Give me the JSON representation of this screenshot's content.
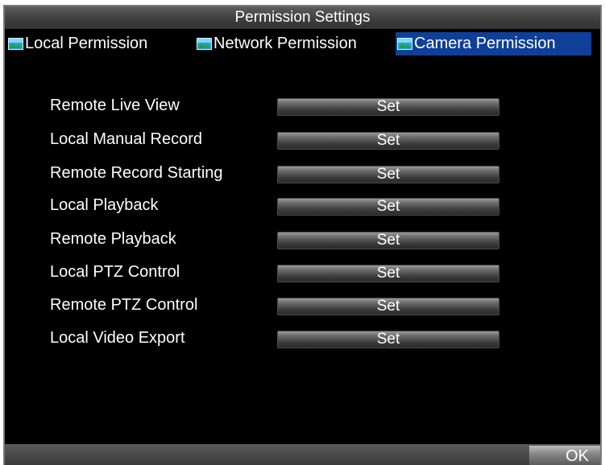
{
  "window": {
    "title": "Permission Settings"
  },
  "tabs": [
    {
      "label": "Local Permission",
      "icon": "network-icon",
      "active": false
    },
    {
      "label": "Network Permission",
      "icon": "network-icon",
      "active": false
    },
    {
      "label": "Camera Permission",
      "icon": "network-icon",
      "active": true
    }
  ],
  "permissions": [
    {
      "label": "Remote Live View",
      "button": "Set"
    },
    {
      "label": "Local Manual Record",
      "button": "Set"
    },
    {
      "label": "Remote Record Starting",
      "button": "Set"
    },
    {
      "label": "Local Playback",
      "button": "Set"
    },
    {
      "label": "Remote Playback",
      "button": "Set"
    },
    {
      "label": "Local PTZ Control",
      "button": "Set"
    },
    {
      "label": "Remote PTZ Control",
      "button": "Set"
    },
    {
      "label": "Local Video Export",
      "button": "Set"
    }
  ],
  "footer": {
    "ok_label": "OK"
  },
  "colors": {
    "background": "#000000",
    "active_tab": "#0f3f99",
    "text": "#ffffff"
  }
}
